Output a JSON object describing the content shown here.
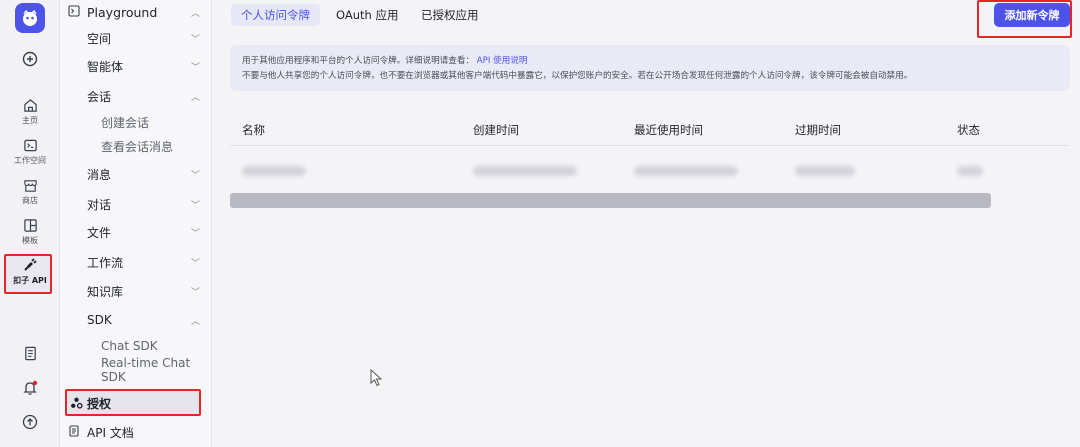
{
  "rail": {
    "items": [
      {
        "icon": "home-icon",
        "label": "主页"
      },
      {
        "icon": "terminal-icon",
        "label": "工作空间"
      },
      {
        "icon": "store-icon",
        "label": "商店"
      },
      {
        "icon": "template-icon",
        "label": "模板"
      },
      {
        "icon": "plug-icon",
        "label": "扣子 API"
      }
    ]
  },
  "sidebar": {
    "title": "Playground",
    "items": [
      {
        "label": "空间"
      },
      {
        "label": "智能体"
      },
      {
        "label": "会话"
      },
      {
        "label": "创建会话"
      },
      {
        "label": "查看会话消息"
      },
      {
        "label": "消息"
      },
      {
        "label": "对话"
      },
      {
        "label": "文件"
      },
      {
        "label": "工作流"
      },
      {
        "label": "知识库"
      },
      {
        "label": "SDK"
      },
      {
        "label": "Chat SDK"
      },
      {
        "label": "Real-time Chat SDK"
      },
      {
        "label": "授权"
      },
      {
        "label": "API 文档"
      }
    ]
  },
  "tabs": [
    {
      "label": "个人访问令牌"
    },
    {
      "label": "OAuth 应用"
    },
    {
      "label": "已授权应用"
    }
  ],
  "add_button": "添加新令牌",
  "notice": {
    "line1": "用于其他应用程序和平台的个人访问令牌。详细说明请查看：",
    "link": "API 使用说明",
    "line2": "不要与他人共享您的个人访问令牌，也不要在浏览器或其他客户端代码中暴露它，以保护您账户的安全。若在公开场合发现任何泄露的个人访问令牌，该令牌可能会被自动禁用。"
  },
  "table": {
    "headers": [
      "名称",
      "创建时间",
      "最近使用时间",
      "过期时间",
      "状态"
    ]
  },
  "colors": {
    "accent": "#4d53e8",
    "highlight": "#e5252a"
  }
}
